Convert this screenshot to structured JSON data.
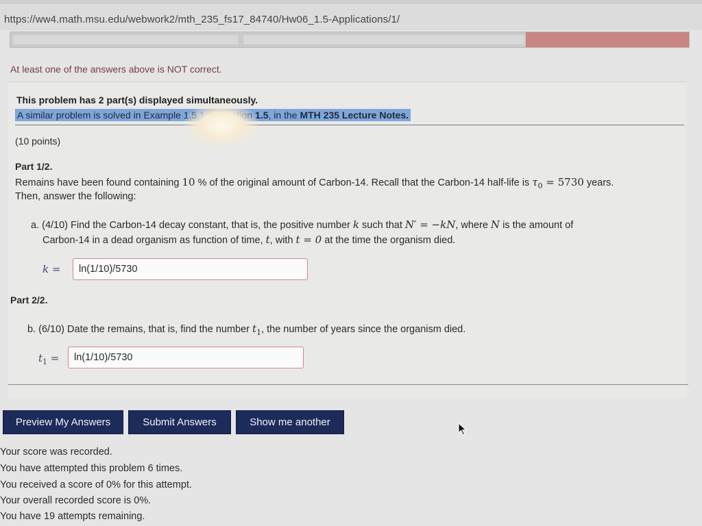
{
  "browser": {
    "url": "https://ww4.math.msu.edu/webwork2/mth_235_fs17_84740/Hw06_1.5-Applications/1/"
  },
  "message": {
    "warning": "At least one of the answers above is NOT correct."
  },
  "problem": {
    "heading": "This problem has 2 part(s) displayed simultaneously.",
    "similar_prefix": "A similar problem is solved in Example 1.5.1, in Section ",
    "similar_section": "1.5",
    "similar_middle": ", in the ",
    "similar_notes": "MTH 235 Lecture Notes.",
    "points": "(10 points)",
    "part1": {
      "label": "Part 1/2.",
      "line1_a": "Remains have been found containing ",
      "line1_pct": "10",
      "line1_b": " % of the original amount of Carbon-14. Recall that the Carbon-14 half-life is ",
      "line1_tau": "τ",
      "line1_tau_sub": "0",
      "line1_eq": " = 5730",
      "line1_c": " years.",
      "line2": "Then, answer the following:",
      "qa_a": "a. (4/10) Find the Carbon-14 decay constant, that is, the positive number ",
      "qa_k": "k",
      "qa_b": " such that ",
      "qa_eq": "N′ = −kN",
      "qa_c": ", where ",
      "qa_N": "N",
      "qa_d": " is the amount of",
      "qa2_a": "Carbon-14 in a dead organism as function of time, ",
      "qa2_t": "t",
      "qa2_b": ", with ",
      "qa2_eq": "t = 0",
      "qa2_c": " at the time the organism died.",
      "answer_label": "k =",
      "answer_value": "ln(1/10)/5730"
    },
    "part2": {
      "label": "Part 2/2.",
      "qb_a": "b. (6/10) Date the remains, that is, find the number ",
      "qb_t": "t",
      "qb_sub": "1",
      "qb_b": ", the number of years since the organism died.",
      "answer_label": "t",
      "answer_label_sub": "1",
      "answer_label_eq": " =",
      "answer_value": "ln(1/10)/5730"
    }
  },
  "buttons": {
    "preview": "Preview My Answers",
    "submit": "Submit Answers",
    "another": "Show me another"
  },
  "status": {
    "line1": "Your score was recorded.",
    "line2": "You have attempted this problem 6 times.",
    "line3": "You received a score of 0% for this attempt.",
    "line4": "Your overall recorded score is 0%.",
    "line5": "You have 19 attempts remaining."
  },
  "colors": {
    "button_bg": "#1d2b5b",
    "warning_text": "#7a3b43",
    "highlight": "#7fa6d9",
    "incorrect_border": "#d4848a"
  }
}
